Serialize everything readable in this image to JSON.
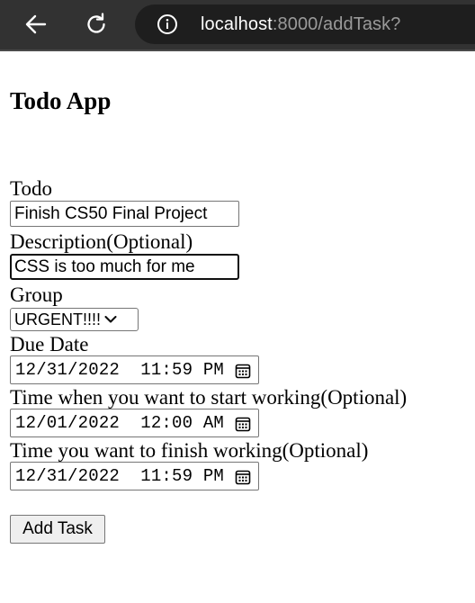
{
  "browser": {
    "url_host": "localhost",
    "url_rest": ":8000/addTask?"
  },
  "page": {
    "title": "Todo App"
  },
  "form": {
    "todo": {
      "label": "Todo",
      "value": "Finish CS50 Final Project"
    },
    "description": {
      "label": "Description(Optional)",
      "value": "CSS is too much for me"
    },
    "group": {
      "label": "Group",
      "selected": "URGENT!!!!"
    },
    "due_date": {
      "label": "Due Date",
      "value": "12/31/2022  11:59 PM"
    },
    "start_time": {
      "label": "Time when you want to start working(Optional)",
      "value": "12/01/2022  12:00 AM"
    },
    "finish_time": {
      "label": "Time you want to finish working(Optional)",
      "value": "12/31/2022  11:59 PM"
    },
    "submit_label": "Add Task"
  },
  "icons": {
    "back": "arrow-left-icon",
    "reload": "reload-icon",
    "info": "info-icon",
    "calendar": "calendar-icon",
    "dropdown": "chevron-down-icon"
  }
}
